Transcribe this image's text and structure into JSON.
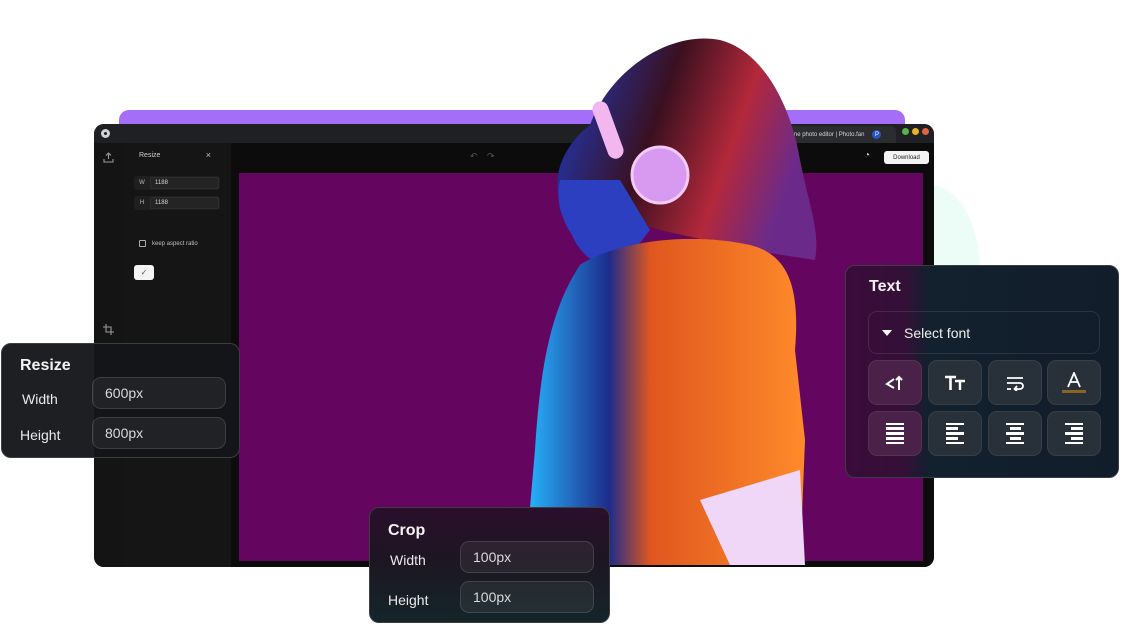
{
  "window": {
    "tab_title": "online photo editor | Photo.fan",
    "tab_close": "×",
    "tab_favicon": "P",
    "download_label": "Download",
    "icons": {
      "upload": "upload-icon",
      "crop": "crop-icon",
      "undo": "undo-icon",
      "redo": "redo-icon",
      "history": "history-icon"
    }
  },
  "resize_panel": {
    "title": "Resize",
    "close": "×",
    "width_label": "W",
    "width_value": "1188",
    "height_label": "H",
    "height_value": "1188",
    "keep_aspect_label": "keep aspect ratio",
    "keep_aspect_checked": false,
    "confirm": "✓"
  },
  "resize_card": {
    "title": "Resize",
    "width_label": "Width",
    "width_value": "600px",
    "height_label": "Height",
    "height_value": "800px"
  },
  "crop_card": {
    "title": "Crop",
    "width_label": "Width",
    "width_value": "100px",
    "height_label": "Height",
    "height_value": "100px"
  },
  "text_card": {
    "title": "Text",
    "font_placeholder": "Select font",
    "tools": [
      {
        "icon": "text-direction-icon",
        "glyph": "◁|"
      },
      {
        "icon": "text-size-icon",
        "glyph": "TT"
      },
      {
        "icon": "text-wrap-icon",
        "glyph": "⤶"
      },
      {
        "icon": "text-color-icon",
        "glyph": "A"
      },
      {
        "icon": "align-justify-icon"
      },
      {
        "icon": "align-left-icon"
      },
      {
        "icon": "align-center-icon"
      },
      {
        "icon": "align-right-icon"
      }
    ],
    "text_color_swatch": "#8a6423"
  },
  "colors": {
    "accent_purple": "#a46ef8",
    "canvas_background": "#640660"
  }
}
